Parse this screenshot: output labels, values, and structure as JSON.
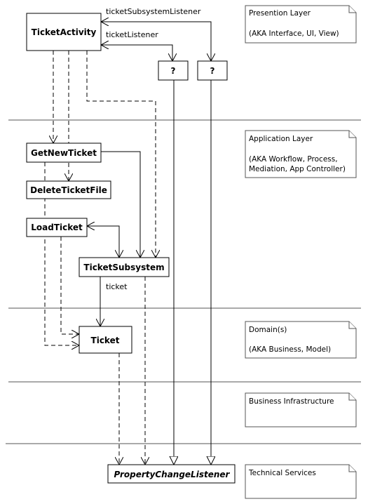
{
  "layers": [
    {
      "title": "Presention Layer",
      "subtitle": "(AKA Interface, UI, View)"
    },
    {
      "title": "Application Layer",
      "subtitle_lines": [
        "(AKA Workflow, Process,",
        "Mediation, App Controller)"
      ]
    },
    {
      "title": "Domain(s)",
      "subtitle": "(AKA Business, Model)"
    },
    {
      "title": "Business Infrastructure"
    },
    {
      "title": "Technical Services"
    }
  ],
  "classes": {
    "ticket_activity": "TicketActivity",
    "unknown_1": "?",
    "unknown_2": "?",
    "get_new_ticket": "GetNewTicket",
    "delete_ticket_file": "DeleteTicketFile",
    "load_ticket": "LoadTicket",
    "ticket_subsystem": "TicketSubsystem",
    "ticket": "Ticket",
    "property_change_listener": "PropertyChangeListener"
  },
  "associations": {
    "ticket_subsystem_listener": "ticketSubsystemListener",
    "ticket_listener": "ticketListener",
    "ticket": "ticket"
  }
}
